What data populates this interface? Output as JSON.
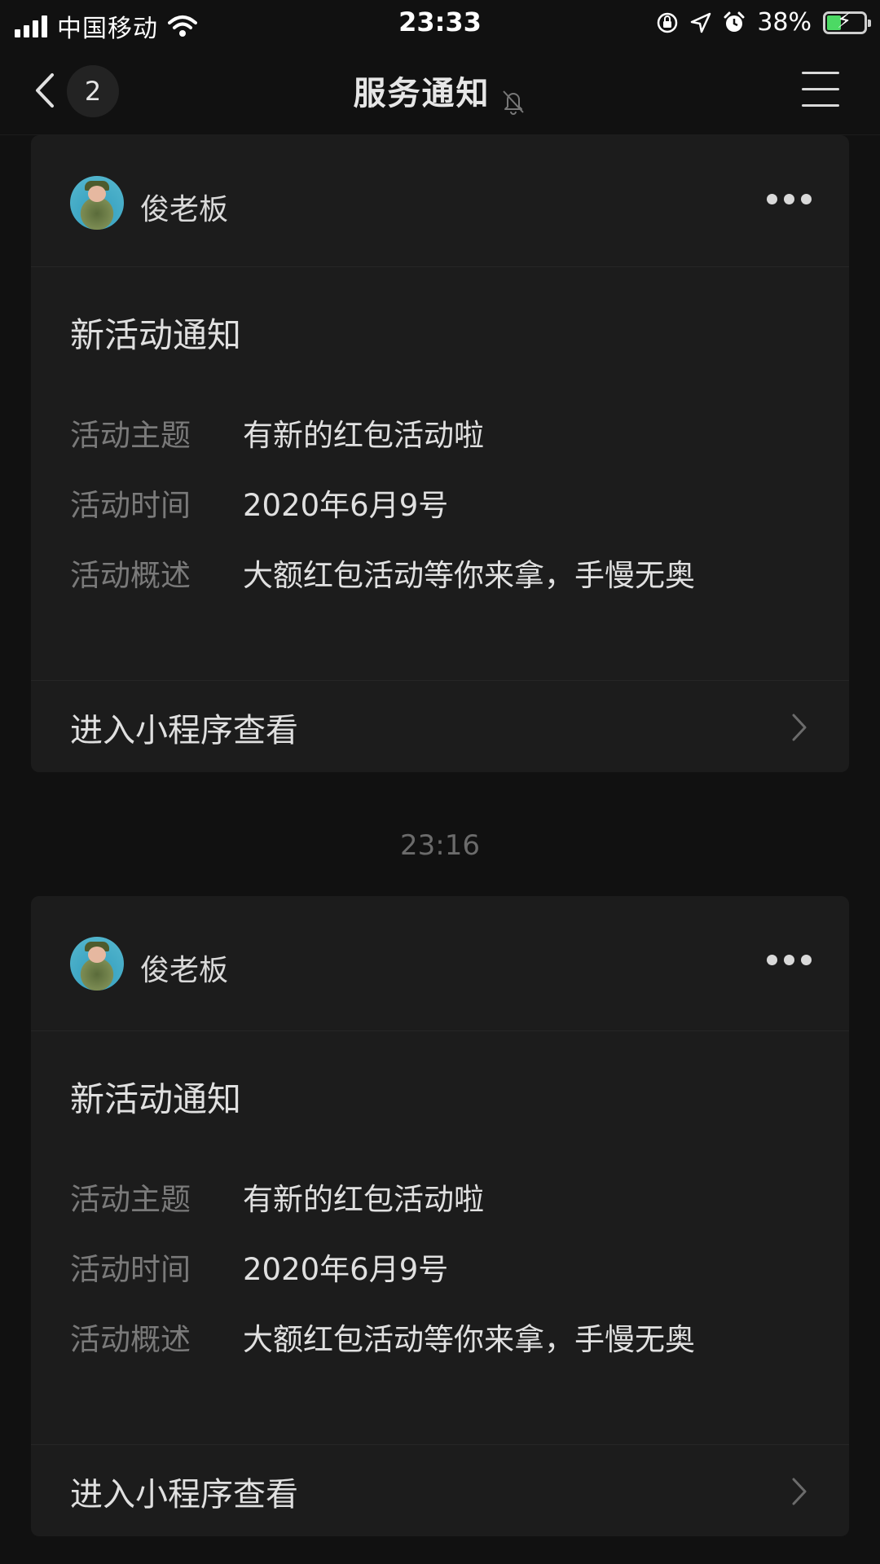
{
  "status_bar": {
    "carrier": "中国移动",
    "time": "23:33",
    "battery_percent": "38%",
    "battery_level": 0.38
  },
  "nav": {
    "back_badge": "2",
    "title": "服务通知",
    "icons": [
      "back-chevron-icon",
      "bell-mute-icon",
      "menu-icon"
    ]
  },
  "messages": [
    {
      "sender": "俊老板",
      "title": "新活动通知",
      "rows": [
        {
          "label": "活动主题",
          "value": "有新的红包活动啦"
        },
        {
          "label": "活动时间",
          "value": "2020年6月9号"
        },
        {
          "label": "活动概述",
          "value": "大额红包活动等你来拿，手慢无奥"
        }
      ],
      "footer": "进入小程序查看"
    },
    {
      "time_divider": "23:16",
      "sender": "俊老板",
      "title": "新活动通知",
      "rows": [
        {
          "label": "活动主题",
          "value": "有新的红包活动啦"
        },
        {
          "label": "活动时间",
          "value": "2020年6月9号"
        },
        {
          "label": "活动概述",
          "value": "大额红包活动等你来拿，手慢无奥"
        }
      ],
      "footer": "进入小程序查看"
    }
  ]
}
